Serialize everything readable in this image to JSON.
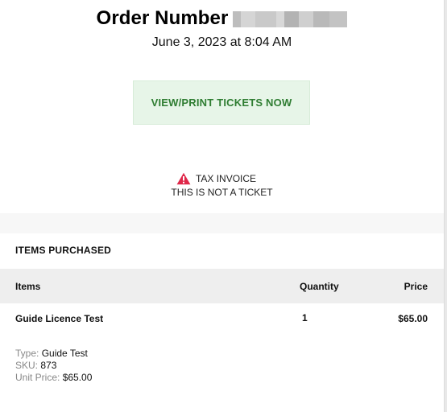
{
  "order": {
    "title": "Order Number",
    "redacted": true,
    "date": "June 3, 2023 at 8:04 AM"
  },
  "actions": {
    "view_print_label": "VIEW/PRINT TICKETS NOW"
  },
  "notice": {
    "icon": "warning-icon",
    "line1": "TAX INVOICE",
    "line2": "THIS IS NOT A TICKET",
    "icon_color": "#e0284a"
  },
  "purchase": {
    "heading": "ITEMS PURCHASED",
    "columns": {
      "items": "Items",
      "quantity": "Quantity",
      "price": "Price"
    },
    "rows": [
      {
        "name": "Guide Licence Test",
        "quantity": "1",
        "price": "$65.00",
        "details": {
          "type_label": "Type:",
          "type_value": "Guide Test",
          "sku_label": "SKU:",
          "sku_value": "873",
          "unit_price_label": "Unit Price:",
          "unit_price_value": "$65.00"
        }
      }
    ]
  },
  "colors": {
    "button_bg": "#e7f5e8",
    "button_text": "#2f7d32",
    "table_header_bg": "#eeeeee"
  }
}
